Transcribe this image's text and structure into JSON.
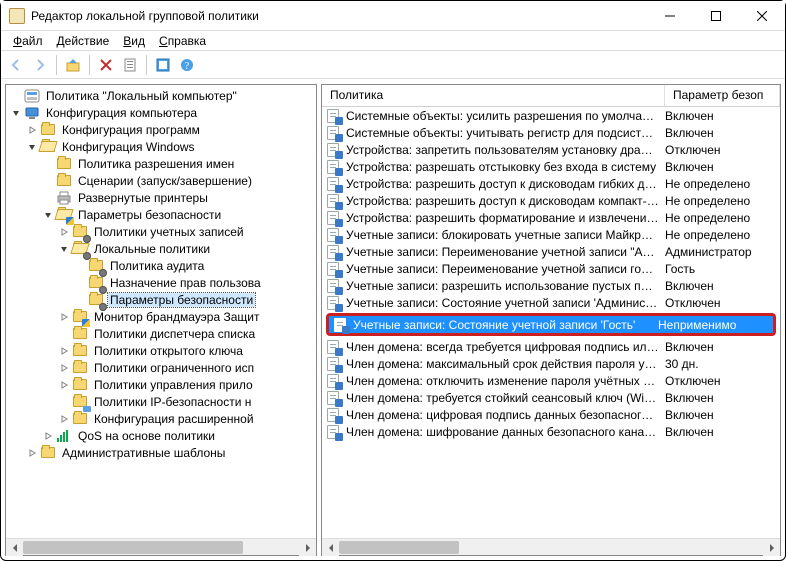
{
  "window": {
    "title": "Редактор локальной групповой политики"
  },
  "menu": {
    "file": "Файл",
    "action": "Действие",
    "view": "Вид",
    "help": "Справка"
  },
  "tree": {
    "root": "Политика \"Локальный компьютер\"",
    "computer_conf": "Конфигурация компьютера",
    "software": "Конфигурация программ",
    "windows_conf": "Конфигурация Windows",
    "name_res": "Политика разрешения имен",
    "scripts": "Сценарии (запуск/завершение)",
    "printers": "Развернутые принтеры",
    "security": "Параметры безопасности",
    "account_pol": "Политики учетных записей",
    "local_pol": "Локальные политики",
    "audit": "Политика аудита",
    "user_rights": "Назначение прав пользова",
    "sec_options": "Параметры безопасности",
    "firewall": "Монитор брандмауэра Защит",
    "netlist": "Политики диспетчера списка",
    "pubkey": "Политики открытого ключа",
    "restrict": "Политики ограниченного исп",
    "appctl": "Политики управления прило",
    "ipsec": "Политики IP-безопасности н",
    "advaudit": "Конфигурация расширенной",
    "qos": "QoS на основе политики",
    "admin_tmpl": "Административные шаблоны"
  },
  "list": {
    "header_policy": "Политика",
    "header_security": "Параметр безоп"
  },
  "policies": [
    {
      "name": "Системные объекты: усилить разрешения по умолчани…",
      "val": "Включен"
    },
    {
      "name": "Системные объекты: учитывать регистр для подсистем, …",
      "val": "Включен"
    },
    {
      "name": "Устройства: запретить пользователям установку драйвер…",
      "val": "Отключен"
    },
    {
      "name": "Устройства: разрешать отстыковку без входа в систему",
      "val": "Включен"
    },
    {
      "name": "Устройства: разрешить доступ к дисководам гибких диск…",
      "val": "Не определено"
    },
    {
      "name": "Устройства: разрешить доступ к дисководам компакт-ди…",
      "val": "Не определено"
    },
    {
      "name": "Устройства: разрешить форматирование и извлечение съ…",
      "val": "Не определено"
    },
    {
      "name": "Учетные записи: блокировать учетные записи Майкросо…",
      "val": "Не определено"
    },
    {
      "name": "Учетные записи: Переименование учетной записи \"Админ…",
      "val": "Администратор"
    },
    {
      "name": "Учетные записи: Переименование учетной записи гостя",
      "val": "Гость"
    },
    {
      "name": "Учетные записи: разрешить использование пустых парол…",
      "val": "Включен"
    },
    {
      "name": "Учетные записи: Состояние учетной записи 'Администра…",
      "val": "Отключен"
    },
    {
      "name": "Учетные записи: Состояние учетной записи 'Гость'",
      "val": "Неприменимо",
      "selected": true,
      "highlighted": true
    },
    {
      "name": "Член домена: всегда требуется цифровая подпись или ш…",
      "val": "Включен"
    },
    {
      "name": "Член домена: максимальный срок действия пароля учетн…",
      "val": "30 дн."
    },
    {
      "name": "Член домена: отключить изменение пароля учётных зап…",
      "val": "Отключен"
    },
    {
      "name": "Член домена: требуется стойкий сеансовый ключ (Wind…",
      "val": "Включен"
    },
    {
      "name": "Член домена: цифровая подпись данных безопасного ка…",
      "val": "Включен"
    },
    {
      "name": "Член домена: шифрование данных безопасного канала, …",
      "val": "Включен"
    }
  ]
}
